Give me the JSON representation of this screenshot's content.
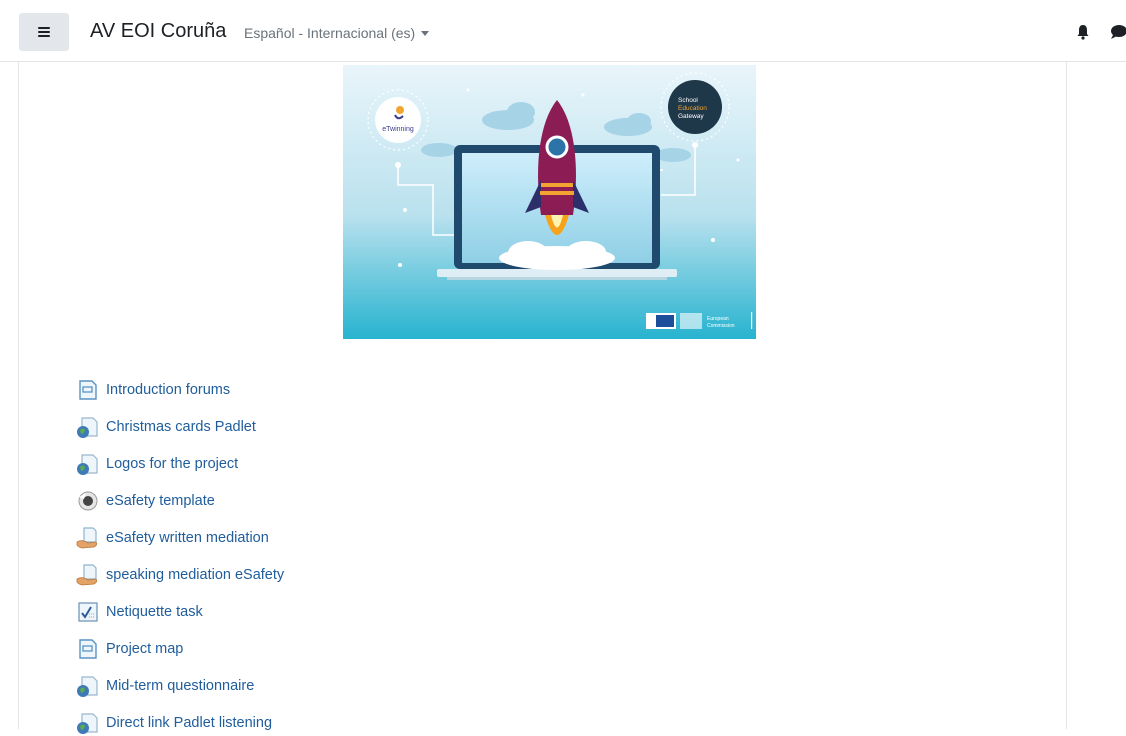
{
  "header": {
    "site_name": "AV EOI Coruña",
    "language": "Español - Internacional (es)",
    "icons": [
      "menu-icon",
      "bell-icon",
      "chat-icon"
    ]
  },
  "banner": {
    "badge_left": "eTwinning",
    "badge_right_line1": "School",
    "badge_right_line2": "Education",
    "badge_right_line3": "Gateway",
    "footer_line1": "European",
    "footer_line2": "Commission"
  },
  "activities": [
    {
      "label": "Introduction forums",
      "icon": "forum-icon"
    },
    {
      "label": "Christmas cards Padlet",
      "icon": "url-globe-icon"
    },
    {
      "label": "Logos for the project",
      "icon": "url-globe-icon"
    },
    {
      "label": "eSafety template",
      "icon": "quiz-icon"
    },
    {
      "label": "eSafety written mediation",
      "icon": "assignment-hand-icon"
    },
    {
      "label": "speaking mediation eSafety",
      "icon": "assignment-hand-icon"
    },
    {
      "label": "Netiquette task",
      "icon": "checklist-icon"
    },
    {
      "label": "Project map",
      "icon": "forum-icon"
    },
    {
      "label": "Mid-term questionnaire",
      "icon": "url-globe-icon"
    },
    {
      "label": "Direct link Padlet listening",
      "icon": "url-globe-icon"
    }
  ]
}
